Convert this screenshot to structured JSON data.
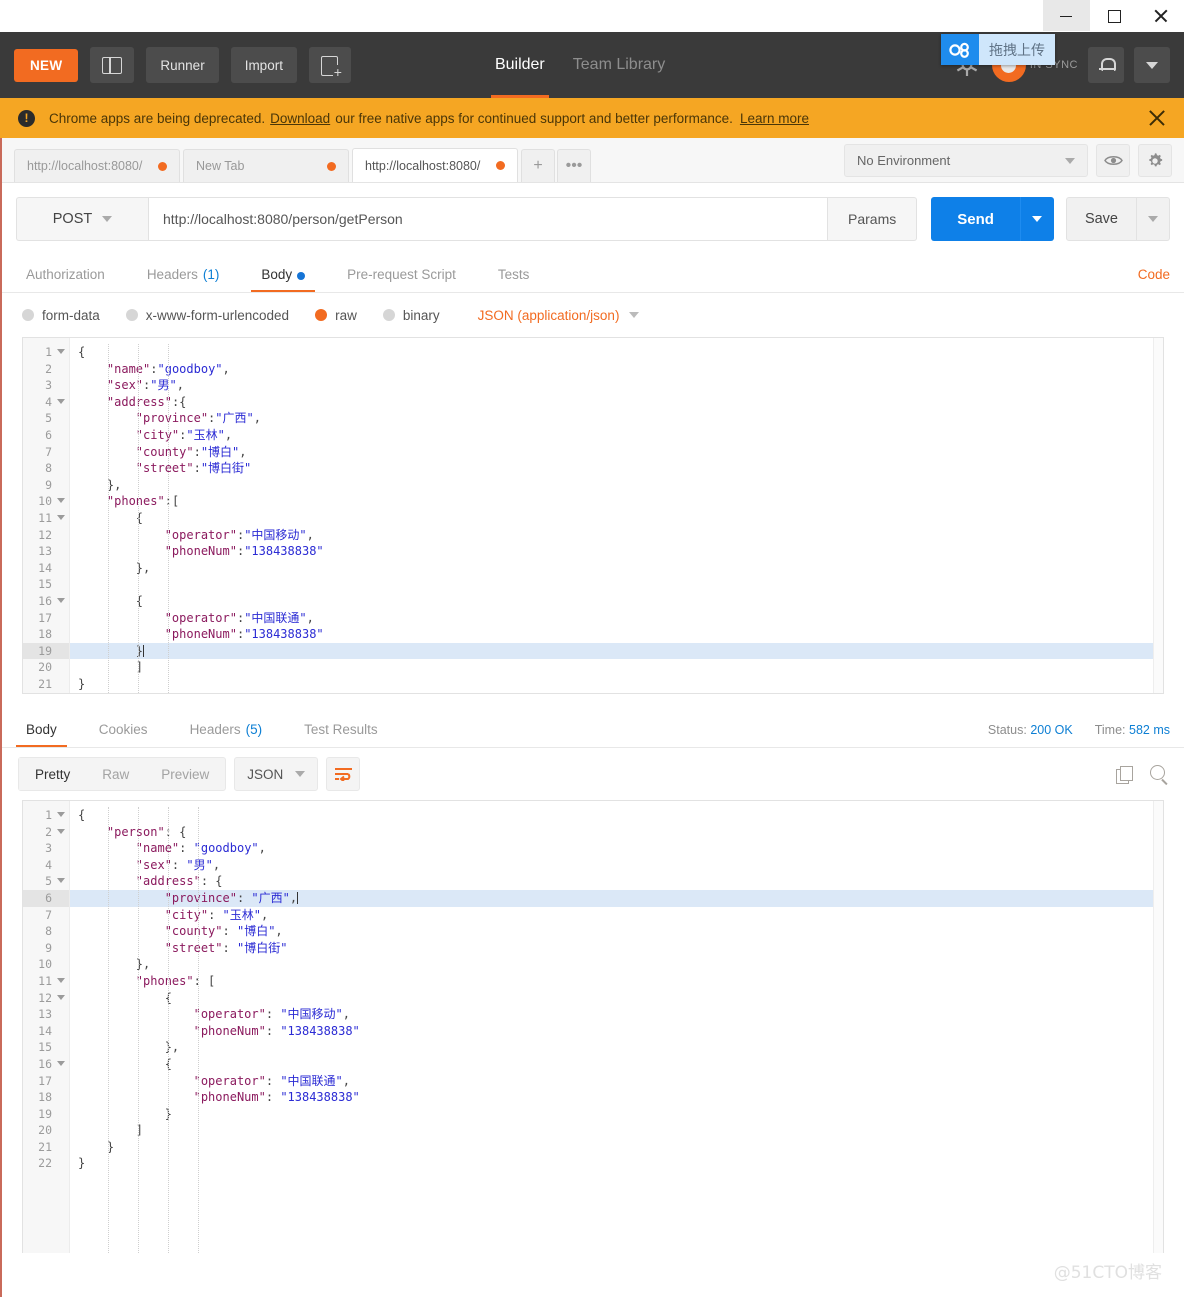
{
  "window": {
    "controls": [
      {
        "name": "minimize",
        "glyph": "minimize-icon"
      },
      {
        "name": "maximize",
        "glyph": "maximize-icon"
      },
      {
        "name": "close",
        "glyph": "close-icon"
      }
    ]
  },
  "toolbar": {
    "new_label": "NEW",
    "panes_label": "",
    "runner_label": "Runner",
    "import_label": "Import",
    "new_window_label": "",
    "tabs": [
      {
        "label": "Builder",
        "active": true
      },
      {
        "label": "Team Library",
        "active": false
      }
    ],
    "sync_label": "IN SYNC",
    "netdisk_overlay": "拖拽上传",
    "netdisk_bg": "#1f8ced"
  },
  "banner": {
    "icon": "!",
    "text_before": "Chrome apps are being deprecated.",
    "link1": "Download",
    "text_middle": "our free native apps for continued support and better performance.",
    "link2": "Learn more",
    "bg": "#f5a623"
  },
  "request_tabs": {
    "items": [
      {
        "label": "http://localhost:8080/",
        "unsaved": true,
        "active": false
      },
      {
        "label": "New Tab",
        "unsaved": true,
        "active": false
      },
      {
        "label": "http://localhost:8080/",
        "unsaved": true,
        "active": true
      }
    ],
    "add_label": "+",
    "more_label": "•••"
  },
  "environment": {
    "selected": "No Environment",
    "eye_title": "quick-look",
    "gear_title": "manage-environments"
  },
  "url_bar": {
    "method": "POST",
    "url": "http://localhost:8080/person/getPerson",
    "params_label": "Params",
    "send_label": "Send",
    "save_label": "Save",
    "send_color": "#0e80e8"
  },
  "request_tabs_row": {
    "items": [
      {
        "label": "Authorization",
        "active": false,
        "count": "",
        "dot": false
      },
      {
        "label": "Headers",
        "active": false,
        "count": "(1)",
        "dot": false
      },
      {
        "label": "Body",
        "active": true,
        "count": "",
        "dot": true
      },
      {
        "label": "Pre-request Script",
        "active": false,
        "count": "",
        "dot": false
      },
      {
        "label": "Tests",
        "active": false,
        "count": "",
        "dot": false
      }
    ],
    "code_link": "Code"
  },
  "body_types": {
    "options": [
      {
        "label": "form-data",
        "selected": false
      },
      {
        "label": "x-www-form-urlencoded",
        "selected": false
      },
      {
        "label": "raw",
        "selected": true
      },
      {
        "label": "binary",
        "selected": false
      }
    ],
    "content_type": "JSON (application/json)"
  },
  "request_body": {
    "highlight_line": 19,
    "lines": [
      {
        "n": 1,
        "fold": true,
        "text": "{"
      },
      {
        "n": 2,
        "fold": false,
        "text": "    \"name\":\"goodboy\","
      },
      {
        "n": 3,
        "fold": false,
        "text": "    \"sex\":\"男\","
      },
      {
        "n": 4,
        "fold": true,
        "text": "    \"address\":{"
      },
      {
        "n": 5,
        "fold": false,
        "text": "        \"province\":\"广西\","
      },
      {
        "n": 6,
        "fold": false,
        "text": "        \"city\":\"玉林\","
      },
      {
        "n": 7,
        "fold": false,
        "text": "        \"county\":\"博白\","
      },
      {
        "n": 8,
        "fold": false,
        "text": "        \"street\":\"博白街\""
      },
      {
        "n": 9,
        "fold": false,
        "text": "    },"
      },
      {
        "n": 10,
        "fold": true,
        "text": "    \"phones\":["
      },
      {
        "n": 11,
        "fold": true,
        "text": "        {"
      },
      {
        "n": 12,
        "fold": false,
        "text": "            \"operator\":\"中国移动\","
      },
      {
        "n": 13,
        "fold": false,
        "text": "            \"phoneNum\":\"138438838\""
      },
      {
        "n": 14,
        "fold": false,
        "text": "        },"
      },
      {
        "n": 15,
        "fold": false,
        "text": ""
      },
      {
        "n": 16,
        "fold": true,
        "text": "        {"
      },
      {
        "n": 17,
        "fold": false,
        "text": "            \"operator\":\"中国联通\","
      },
      {
        "n": 18,
        "fold": false,
        "text": "            \"phoneNum\":\"138438838\""
      },
      {
        "n": 19,
        "fold": false,
        "text": "        }"
      },
      {
        "n": 20,
        "fold": false,
        "text": "        ]"
      },
      {
        "n": 21,
        "fold": false,
        "text": "}"
      }
    ]
  },
  "response": {
    "tabs": [
      {
        "label": "Body",
        "active": true,
        "count": ""
      },
      {
        "label": "Cookies",
        "active": false,
        "count": ""
      },
      {
        "label": "Headers",
        "active": false,
        "count": "(5)"
      },
      {
        "label": "Test Results",
        "active": false,
        "count": ""
      }
    ],
    "status_label": "Status:",
    "status_value": "200 OK",
    "time_label": "Time:",
    "time_value": "582 ms",
    "view_modes": [
      {
        "label": "Pretty",
        "active": true
      },
      {
        "label": "Raw",
        "active": false
      },
      {
        "label": "Preview",
        "active": false
      }
    ],
    "format": "JSON",
    "wrap_icon": "word-wrap-icon",
    "wrap_color": "#f26b21",
    "copy_icon": "copy-icon",
    "search_icon": "search-icon"
  },
  "response_body": {
    "highlight_line": 6,
    "lines": [
      {
        "n": 1,
        "fold": true,
        "text": "{"
      },
      {
        "n": 2,
        "fold": true,
        "text": "    \"person\": {"
      },
      {
        "n": 3,
        "fold": false,
        "text": "        \"name\": \"goodboy\","
      },
      {
        "n": 4,
        "fold": false,
        "text": "        \"sex\": \"男\","
      },
      {
        "n": 5,
        "fold": true,
        "text": "        \"address\": {"
      },
      {
        "n": 6,
        "fold": false,
        "text": "            \"province\": \"广西\","
      },
      {
        "n": 7,
        "fold": false,
        "text": "            \"city\": \"玉林\","
      },
      {
        "n": 8,
        "fold": false,
        "text": "            \"county\": \"博白\","
      },
      {
        "n": 9,
        "fold": false,
        "text": "            \"street\": \"博白街\""
      },
      {
        "n": 10,
        "fold": false,
        "text": "        },"
      },
      {
        "n": 11,
        "fold": true,
        "text": "        \"phones\": ["
      },
      {
        "n": 12,
        "fold": true,
        "text": "            {"
      },
      {
        "n": 13,
        "fold": false,
        "text": "                \"operator\": \"中国移动\","
      },
      {
        "n": 14,
        "fold": false,
        "text": "                \"phoneNum\": \"138438838\""
      },
      {
        "n": 15,
        "fold": false,
        "text": "            },"
      },
      {
        "n": 16,
        "fold": true,
        "text": "            {"
      },
      {
        "n": 17,
        "fold": false,
        "text": "                \"operator\": \"中国联通\","
      },
      {
        "n": 18,
        "fold": false,
        "text": "                \"phoneNum\": \"138438838\""
      },
      {
        "n": 19,
        "fold": false,
        "text": "            }"
      },
      {
        "n": 20,
        "fold": false,
        "text": "        ]"
      },
      {
        "n": 21,
        "fold": false,
        "text": "    }"
      },
      {
        "n": 22,
        "fold": false,
        "text": "}"
      }
    ]
  },
  "watermark": "@51CTO博客"
}
